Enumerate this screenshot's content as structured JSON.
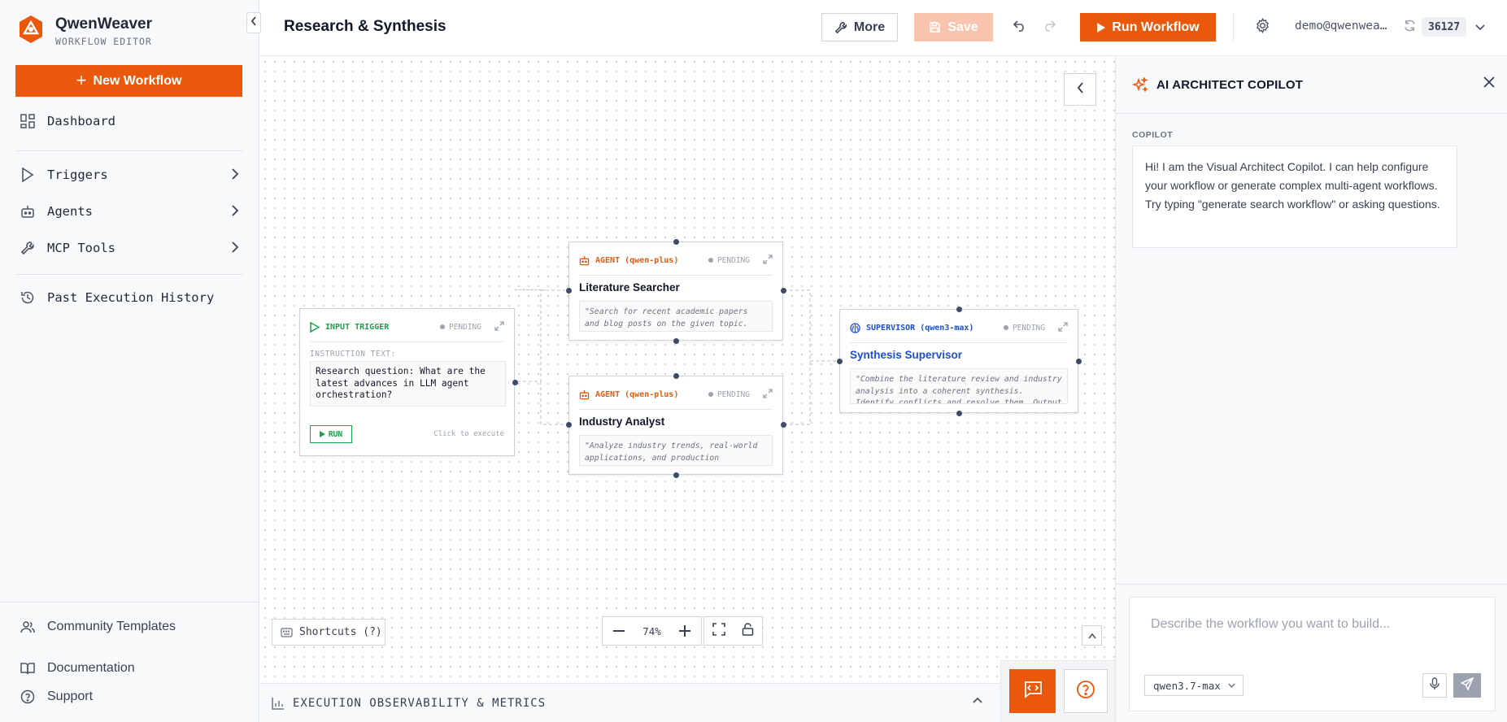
{
  "brand": {
    "name": "QwenWeaver",
    "subtitle": "WORKFLOW EDITOR",
    "accent": "#ea580c"
  },
  "sidebar": {
    "new_workflow_label": "New Workflow",
    "items": [
      {
        "label": "Dashboard",
        "icon": "dashboard-icon"
      },
      {
        "label": "Triggers",
        "icon": "play-icon"
      },
      {
        "label": "Agents",
        "icon": "bot-icon"
      },
      {
        "label": "MCP Tools",
        "icon": "wrench-icon"
      },
      {
        "label": "Past Execution History",
        "icon": "history-icon"
      }
    ],
    "bottom": [
      {
        "label": "Community Templates",
        "icon": "users-icon"
      },
      {
        "label": "Documentation",
        "icon": "book-icon"
      },
      {
        "label": "Support",
        "icon": "help-circle-icon"
      }
    ]
  },
  "topbar": {
    "title": "Research & Synthesis",
    "more_label": "More",
    "save_label": "Save",
    "run_label": "Run Workflow",
    "user_email": "demo@qwenwea…",
    "badge": "36127"
  },
  "canvas": {
    "zoom": "74%",
    "shortcuts_label": "Shortcuts (?)",
    "nodes": {
      "trigger": {
        "type": "INPUT TRIGGER",
        "status": "PENDING",
        "field_label": "INSTRUCTION TEXT:",
        "value": "Research question: What are the latest advances in LLM agent orchestration?",
        "run_label": "RUN",
        "hint": "Click to execute"
      },
      "lit": {
        "type": "AGENT (qwen-plus)",
        "status": "PENDING",
        "title": "Literature Searcher",
        "desc": "\"Search for recent academic papers and blog posts on the given topic. Summarize key findings, methodologies, and"
      },
      "ind": {
        "type": "AGENT (qwen-plus)",
        "status": "PENDING",
        "title": "Industry Analyst",
        "desc": "\"Analyze industry trends, real-world applications, and production deployments related to the topic. Focus on practical"
      },
      "sup": {
        "type": "SUPERVISOR (qwen3-max)",
        "status": "PENDING",
        "title": "Synthesis Supervisor",
        "desc": "\"Combine the literature review and industry analysis into a coherent synthesis. Identify conflicts and resolve them. Output a"
      }
    }
  },
  "observability": {
    "label": "EXECUTION OBSERVABILITY & METRICS"
  },
  "copilot": {
    "title": "AI ARCHITECT COPILOT",
    "role": "COPILOT",
    "message": "Hi! I am the Visual Architect Copilot. I can help configure your workflow or generate complex multi-agent workflows. Try typing \"generate search workflow\" or asking questions.",
    "placeholder": "Describe the workflow you want to build...",
    "model": "qwen3.7-max"
  }
}
